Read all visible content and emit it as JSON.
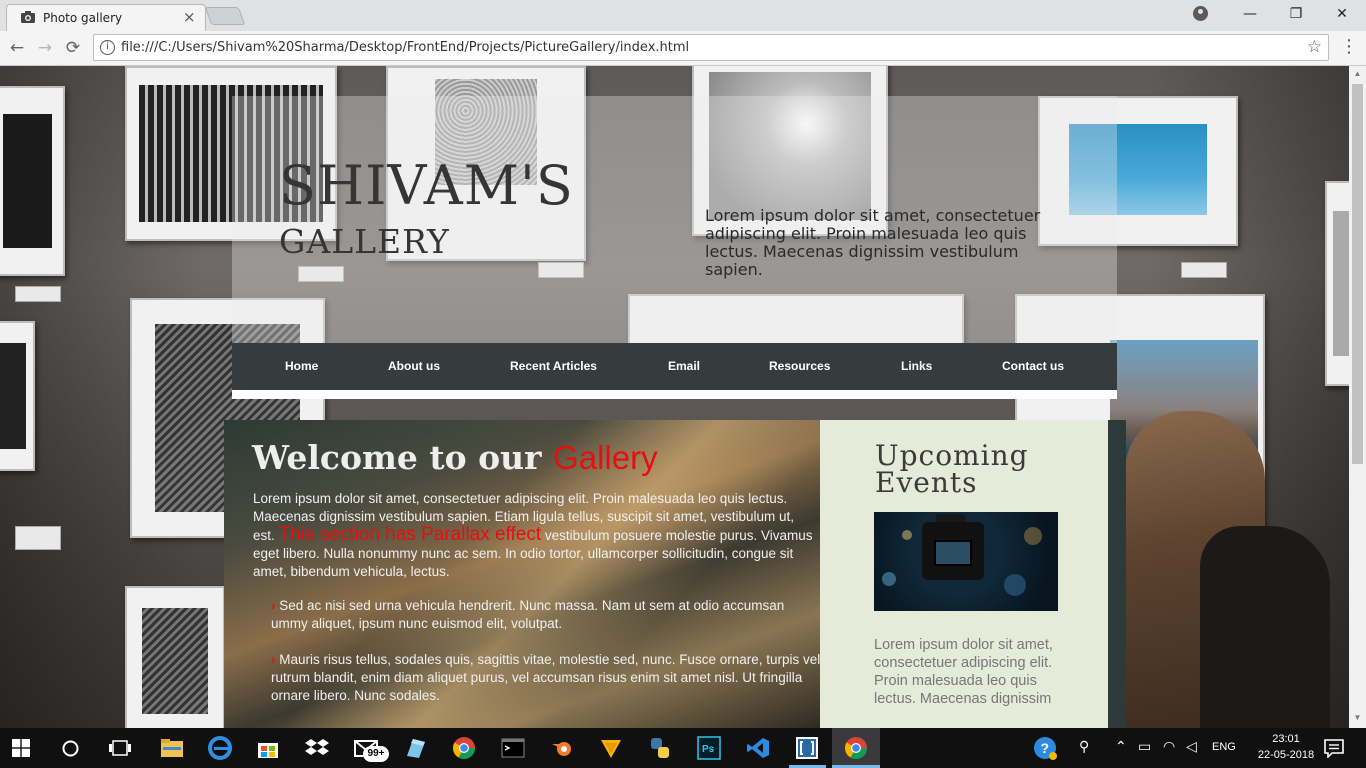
{
  "browser": {
    "tab_title": "Photo gallery",
    "tab_close": "×",
    "url": "file:///C:/Users/Shivam%20Sharma/Desktop/FrontEnd/Projects/PictureGallery/index.html",
    "back": "←",
    "forward": "→",
    "reload": "⟳",
    "info": "i",
    "star": "☆",
    "menu": "⋮",
    "minimize": "—",
    "restore": "❐",
    "close": "✕"
  },
  "site": {
    "logo_main": "SHIVAM'S",
    "logo_sub": "GALLERY",
    "header_text": "Lorem ipsum dolor sit amet, consectetuer adipiscing elit. Proin malesuada leo quis lectus. Maecenas dignissim vestibulum sapien.",
    "nav": [
      "Home",
      "About us",
      "Recent Articles",
      "Email",
      "Resources",
      "Links",
      "Contact us"
    ],
    "welcome": {
      "title_prefix": "Welcome to our",
      "title_accent": "Gallery",
      "para_start": "Lorem ipsum dolor sit amet, consectetuer adipiscing elit. Proin malesuada leo quis lectus. Maecenas dignissim vestibulum sapien. Etiam ligula tellus, suscipit sit amet, vestibulum ut, est.",
      "para_highlight": "This section has Parallax effect",
      "para_end": "vestibulum posuere molestie purus. Vivamus eget libero. Nulla nonummy nunc ac sem. In odio tortor, ullamcorper sollicitudin, congue sit amet, bibendum vehicula, lectus.",
      "bullet_marker": "›",
      "bullets": [
        "Sed ac nisi sed urna vehicula hendrerit. Nunc massa. Nam ut sem at odio accumsan ummy aliquet, ipsum nunc euismod elit, volutpat.",
        "Mauris risus tellus, sodales quis, sagittis vitae, molestie sed, nunc. Fusce ornare, turpis vel rutrum blandit, enim diam aliquet purus, vel accumsan risus enim sit amet nisl. Ut fringilla ornare libero. Nunc sodales."
      ]
    },
    "sidebar": {
      "title_line1": "Upcoming",
      "title_line2": "Events",
      "text": "Lorem ipsum dolor sit amet, consectetuer adipiscing elit. Proin malesuada leo quis lectus. Maecenas dignissim"
    }
  },
  "taskbar": {
    "badge": "99+",
    "lang": "ENG",
    "time": "23:01",
    "date": "22-05-2018"
  }
}
